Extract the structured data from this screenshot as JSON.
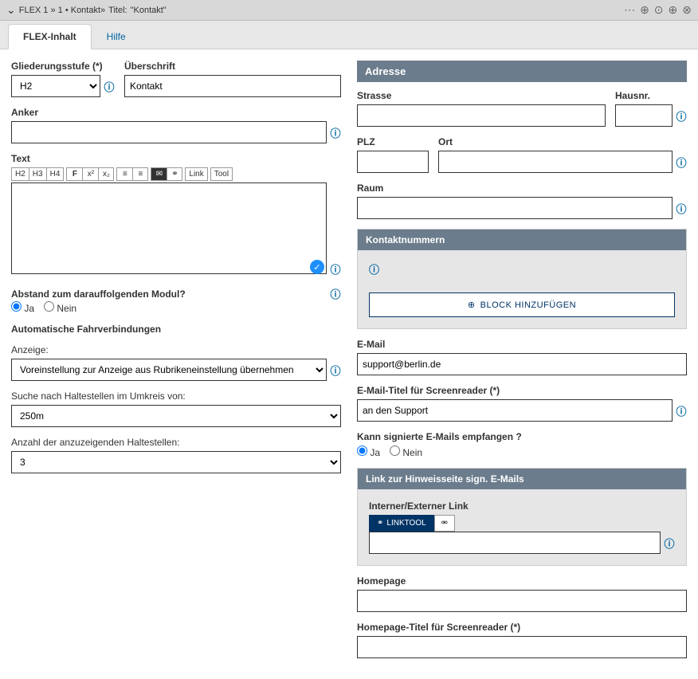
{
  "header": {
    "breadcrumb_prefix": "FLEX 1 »  1 • Kontakt»",
    "breadcrumb_title_label": "Titel:",
    "breadcrumb_title_value": "\"Kontakt\""
  },
  "tabs": {
    "tab1": "FLEX-Inhalt",
    "tab2": "Hilfe"
  },
  "left": {
    "gliederung_label": "Gliederungsstufe (*)",
    "gliederung_value": "H2",
    "ueberschrift_label": "Überschrift",
    "ueberschrift_value": "Kontakt",
    "anker_label": "Anker",
    "anker_value": "",
    "text_label": "Text",
    "toolbar": {
      "h2": "H2",
      "h3": "H3",
      "h4": "H4",
      "bold": "F",
      "sup": "x²",
      "sub": "x₂",
      "ul": "≡",
      "ol": "≡",
      "link": "Link",
      "tool": "Tool"
    },
    "abstand_label": "Abstand zum darauffolgenden Modul?",
    "ja": "Ja",
    "nein": "Nein",
    "fahrverbindungen_label": "Automatische Fahrverbindungen",
    "anzeige_label": "Anzeige:",
    "anzeige_value": "Voreinstellung zur Anzeige aus Rubrikeneinstellung übernehmen",
    "suche_label": "Suche nach Haltestellen im Umkreis von:",
    "suche_value": "250m",
    "anzahl_label": "Anzahl der anzuzeigenden Haltestellen:",
    "anzahl_value": "3"
  },
  "right": {
    "adresse_header": "Adresse",
    "strasse_label": "Strasse",
    "hausnr_label": "Hausnr.",
    "plz_label": "PLZ",
    "ort_label": "Ort",
    "raum_label": "Raum",
    "kontaktnummern_header": "Kontaktnummern",
    "add_block": "BLOCK HINZUFÜGEN",
    "email_label": "E-Mail",
    "email_value": "support@berlin.de",
    "email_titel_label": "E-Mail-Titel für Screenreader (*)",
    "email_titel_value": "an den Support",
    "signierte_label": "Kann signierte E-Mails empfangen ?",
    "ja": "Ja",
    "nein": "Nein",
    "link_hinweis_header": "Link zur Hinweisseite sign. E-Mails",
    "interner_link_label": "Interner/Externer Link",
    "linktool_label": "LINKTOOL",
    "homepage_label": "Homepage",
    "homepage_titel_label": "Homepage-Titel für Screenreader (*)"
  }
}
